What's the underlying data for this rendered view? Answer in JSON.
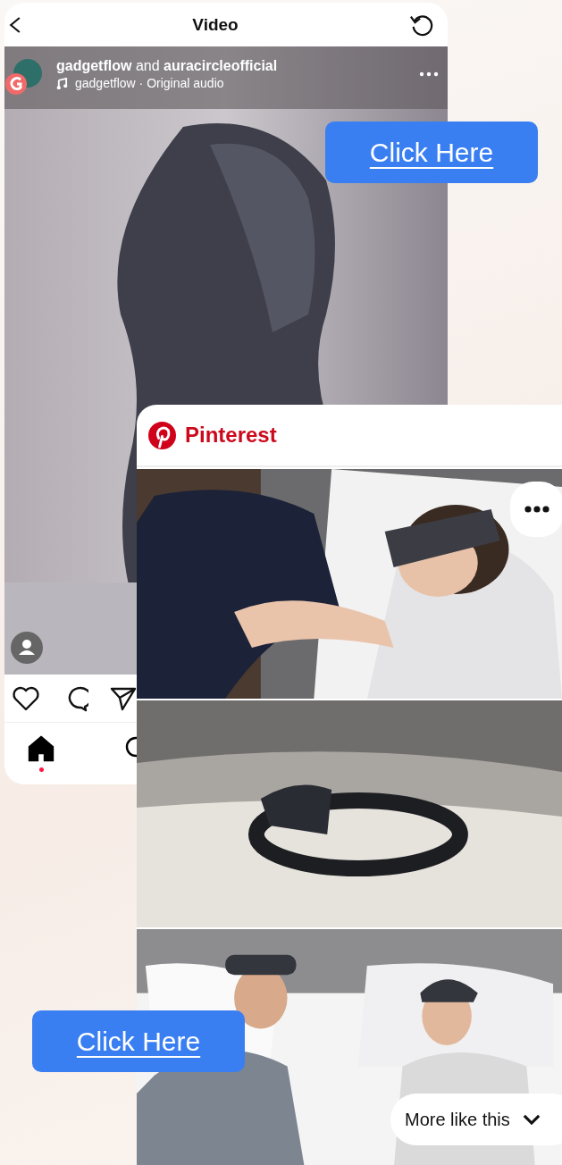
{
  "instagram": {
    "title": "Video",
    "post": {
      "author_line": "**gadgetflow** and **auracircleofficial**",
      "audio": "gadgetflow · Original audio"
    },
    "nav_items": [
      {
        "selected": true
      },
      {
        "selected": false
      }
    ]
  },
  "pinterest": {
    "brand": "Pinterest",
    "more_button": "More like this"
  },
  "cta_buttons": [
    "Click Here",
    "Click Here"
  ]
}
